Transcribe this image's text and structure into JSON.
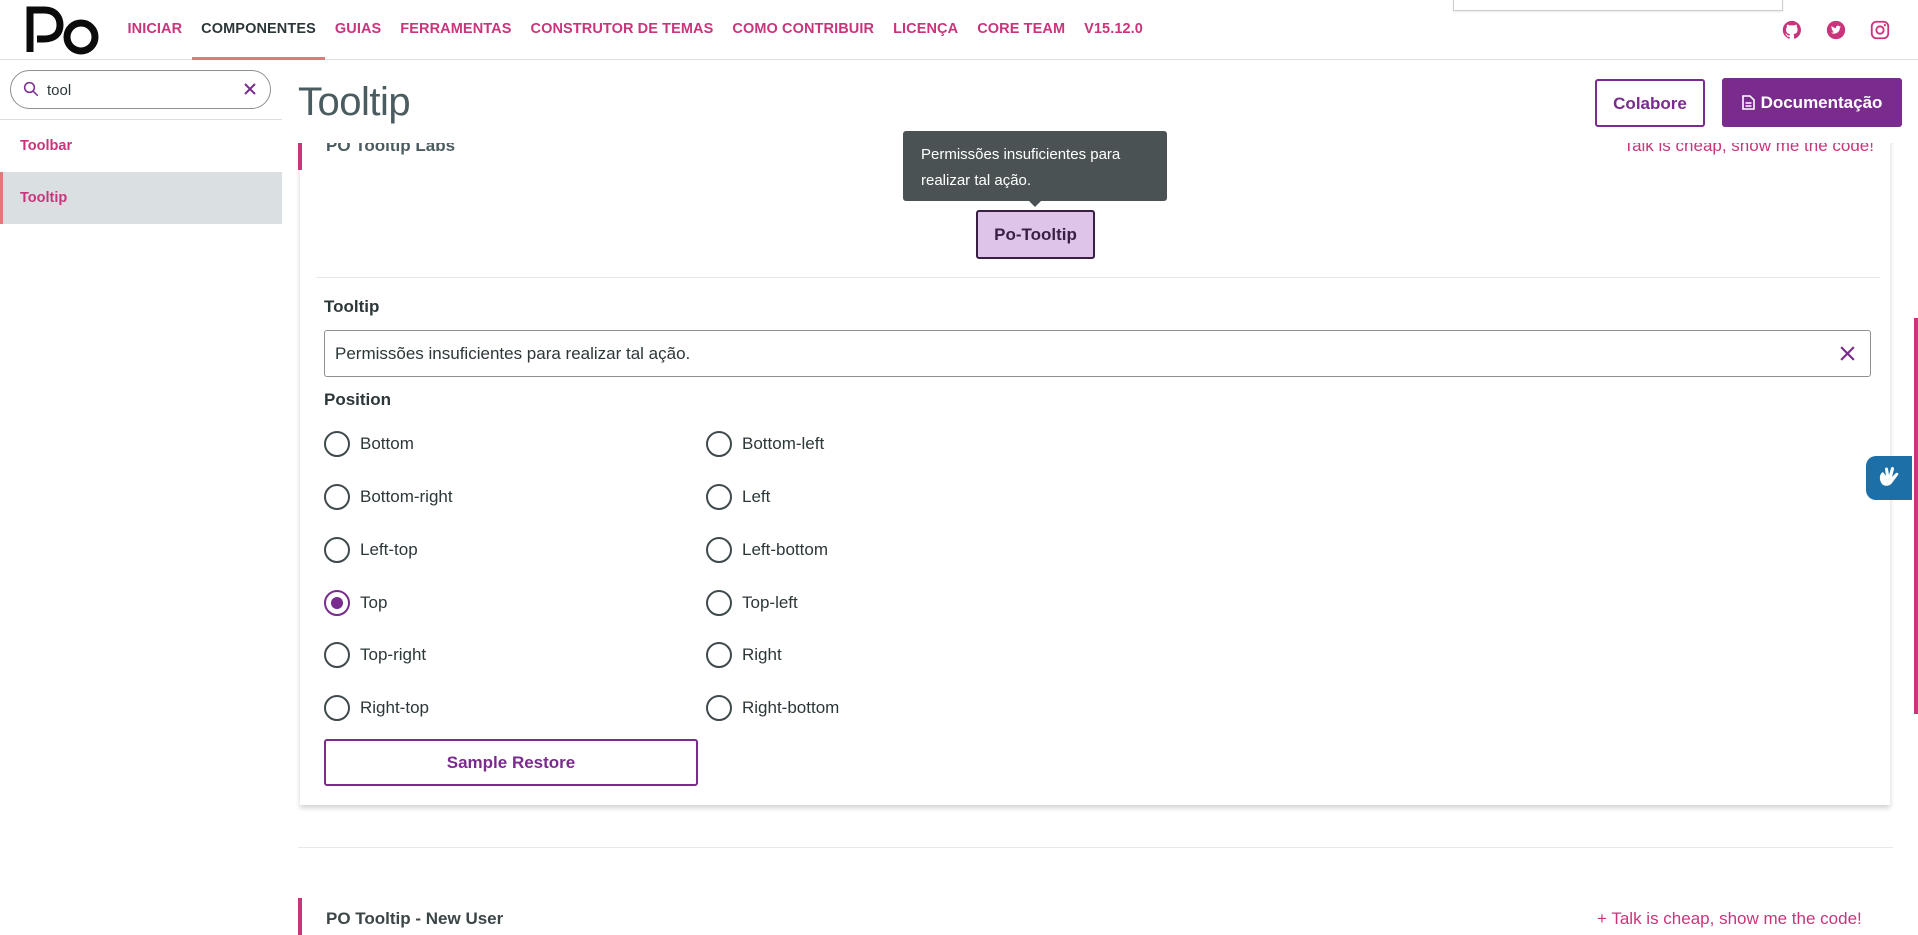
{
  "header": {
    "logo_text": "PO",
    "nav": [
      {
        "label": "INICIAR",
        "active": false
      },
      {
        "label": "COMPONENTES",
        "active": true
      },
      {
        "label": "GUIAS",
        "active": false
      },
      {
        "label": "FERRAMENTAS",
        "active": false
      },
      {
        "label": "CONSTRUTOR DE TEMAS",
        "active": false
      },
      {
        "label": "COMO CONTRIBUIR",
        "active": false
      },
      {
        "label": "LICENÇA",
        "active": false
      },
      {
        "label": "CORE TEAM",
        "active": false
      },
      {
        "label": "V15.12.0",
        "active": false
      }
    ],
    "social_icons": [
      "github-icon",
      "twitter-icon",
      "instagram-icon"
    ]
  },
  "sidebar": {
    "search": {
      "value": "tool",
      "placeholder": ""
    },
    "items": [
      {
        "label": "Toolbar",
        "active": false
      },
      {
        "label": "Tooltip",
        "active": true
      }
    ]
  },
  "main": {
    "title": "Tooltip",
    "colabore_label": "Colabore",
    "doc_label": "Documentação",
    "sample": {
      "title": "PO Tooltip Labs",
      "code_link": "Talk is cheap, show me the code!",
      "tooltip_text": "Permissões insuficientes para realizar tal ação.",
      "tooltip_button": "Po-Tooltip",
      "tooltip_field_label": "Tooltip",
      "tooltip_field_value": "Permissões insuficientes para realizar tal ação.",
      "position_label": "Position",
      "positions": [
        {
          "label": "Bottom",
          "checked": false
        },
        {
          "label": "Bottom-left",
          "checked": false
        },
        {
          "label": "Bottom-right",
          "checked": false
        },
        {
          "label": "Left",
          "checked": false
        },
        {
          "label": "Left-top",
          "checked": false
        },
        {
          "label": "Left-bottom",
          "checked": false
        },
        {
          "label": "Top",
          "checked": true
        },
        {
          "label": "Top-left",
          "checked": false
        },
        {
          "label": "Top-right",
          "checked": false
        },
        {
          "label": "Right",
          "checked": false
        },
        {
          "label": "Right-top",
          "checked": false
        },
        {
          "label": "Right-bottom",
          "checked": false
        }
      ],
      "restore_label": "Sample Restore"
    },
    "next_sample": {
      "title": "PO Tooltip - New User",
      "code_link": "+ Talk is cheap, show me the code!"
    }
  },
  "colors": {
    "primary": "#7a2b8e",
    "accent": "#c9347b",
    "tooltip_bg": "#4a5254"
  }
}
